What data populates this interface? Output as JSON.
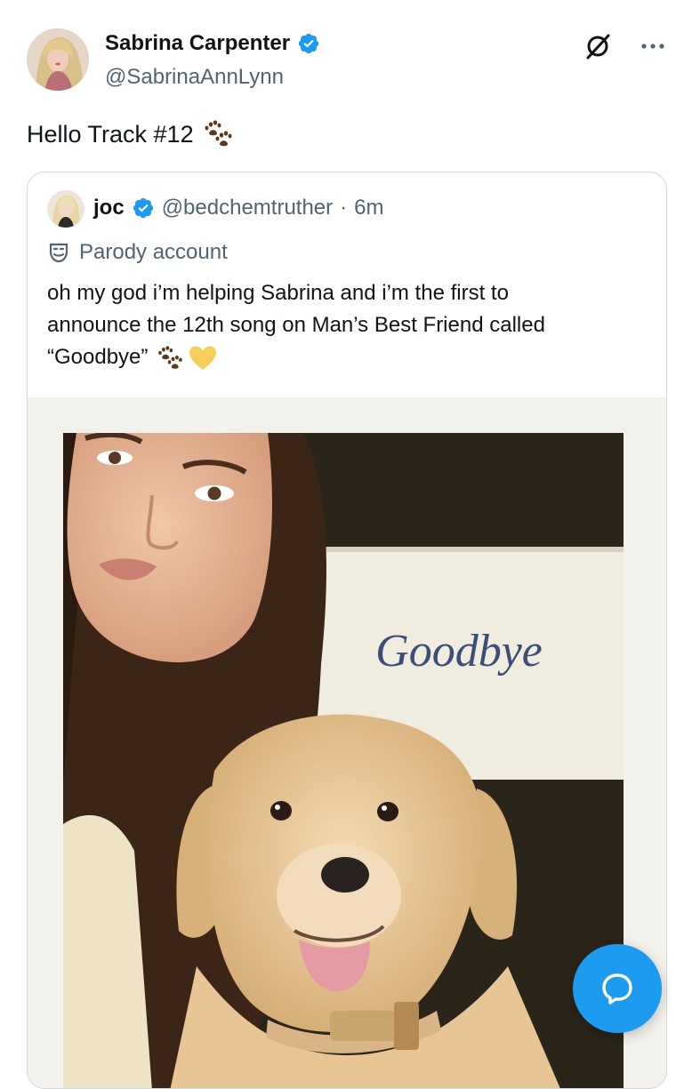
{
  "post": {
    "author_name": "Sabrina Carpenter",
    "author_handle": "@SabrinaAnnLynn",
    "text": "Hello Track #12",
    "text_emoji": "paw-prints-icon"
  },
  "quote": {
    "author_name": "joc",
    "author_handle": "@bedchemtruther",
    "separator": "·",
    "time": "6m",
    "parody_label": "Parody account",
    "text_lines": [
      "oh my god i’m helping Sabrina and i’m the first to",
      "announce the 12th song on Man’s Best Friend called",
      "“Goodbye”"
    ],
    "text_emojis": [
      "paw-prints-icon",
      "yellow-heart-icon"
    ],
    "image_sign_text": "Goodbye"
  },
  "colors": {
    "brand_blue": "#1d9bf0",
    "secondary_text": "#536471",
    "border": "#cfd9de"
  }
}
